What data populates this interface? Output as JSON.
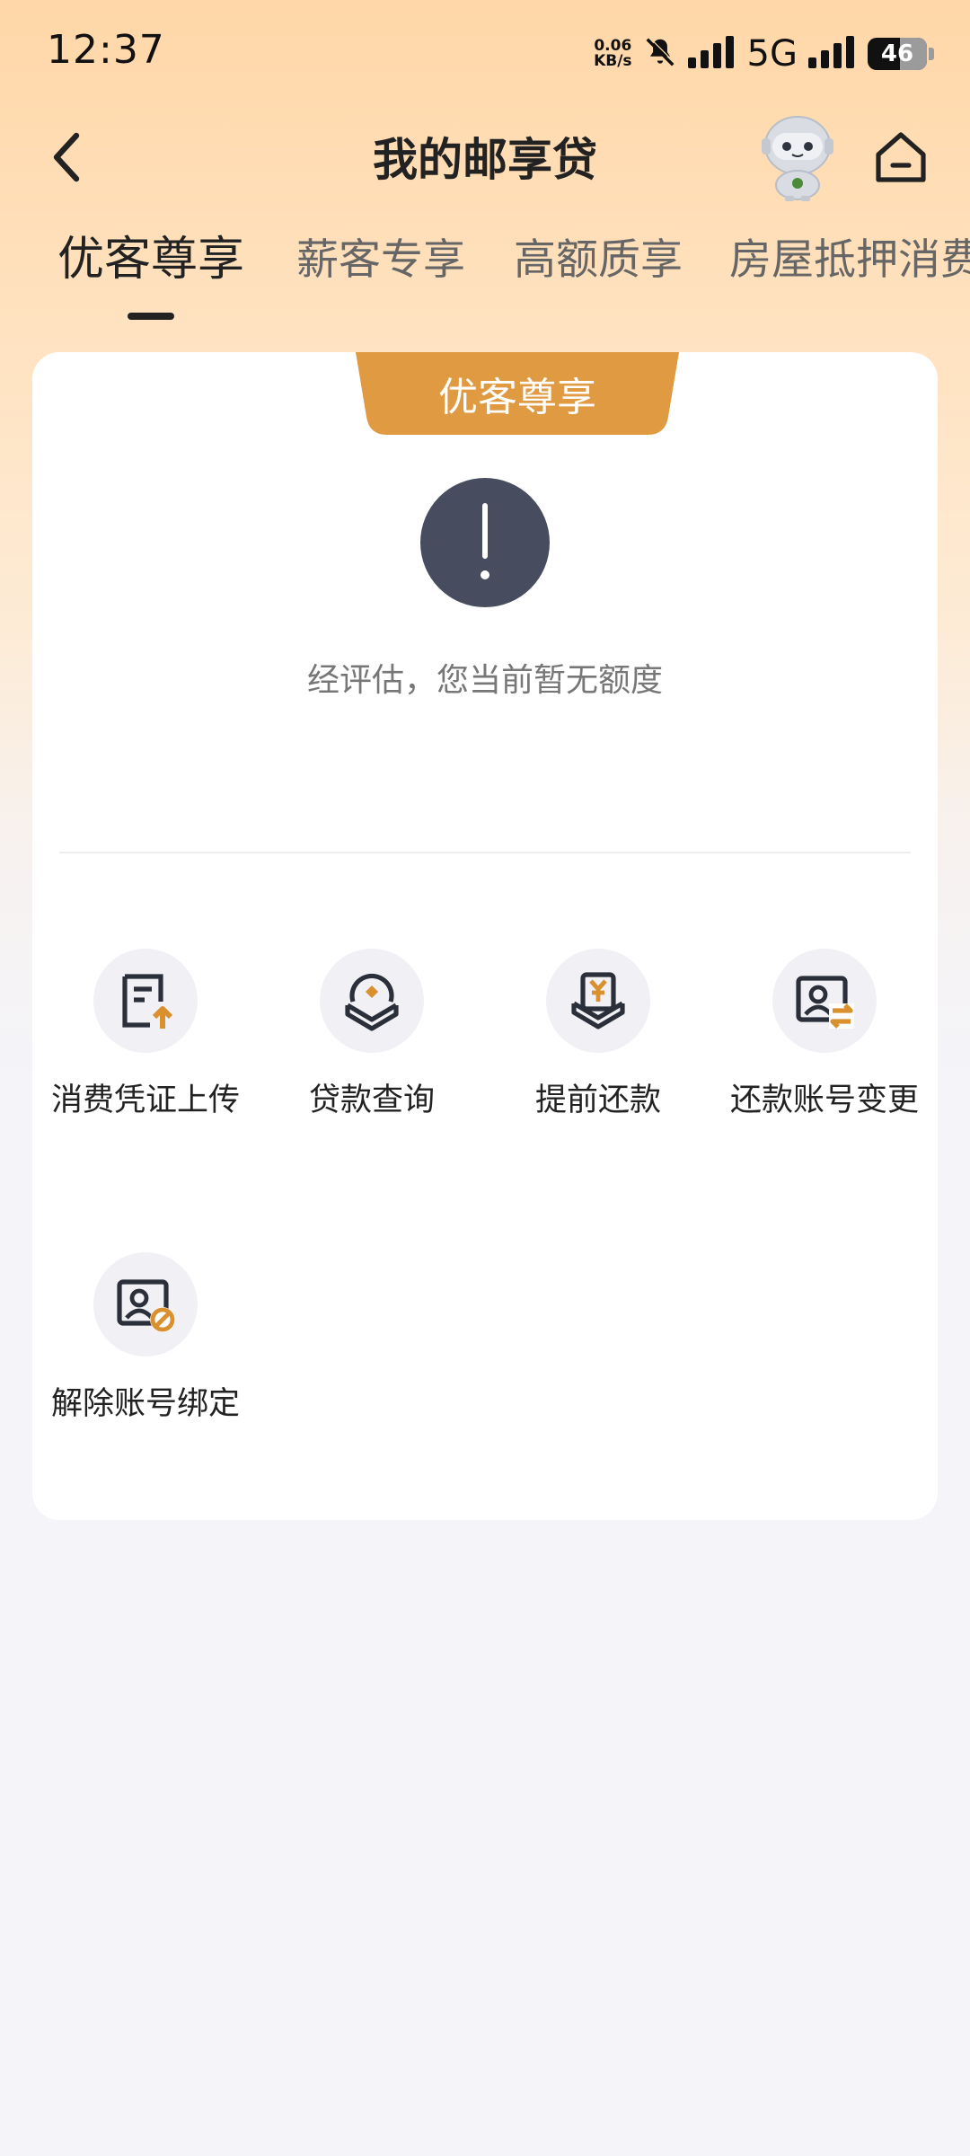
{
  "status_bar": {
    "time": "12:37",
    "net_speed_value": "0.06",
    "net_speed_unit": "KB/s",
    "network_type": "5G",
    "battery_level": "46",
    "icons": [
      "mute-icon",
      "signal-icon",
      "signal-icon"
    ]
  },
  "header": {
    "title": "我的邮享贷",
    "back_icon": "chevron-left-icon",
    "assistant_icon": "robot-assistant-icon",
    "home_icon": "home-icon"
  },
  "tabs": [
    {
      "label": "优客尊享",
      "active": true
    },
    {
      "label": "薪客专享",
      "active": false
    },
    {
      "label": "高额质享",
      "active": false
    },
    {
      "label": "房屋抵押消费",
      "active": false
    }
  ],
  "card": {
    "badge_label": "优客尊享",
    "status_icon": "exclamation-icon",
    "message": "经评估，您当前暂无额度",
    "actions": [
      {
        "label": "消费凭证上传",
        "icon": "voucher-upload-icon"
      },
      {
        "label": "贷款查询",
        "icon": "loan-query-icon"
      },
      {
        "label": "提前还款",
        "icon": "early-repayment-icon"
      },
      {
        "label": "还款账号变更",
        "icon": "account-change-icon"
      },
      {
        "label": "解除账号绑定",
        "icon": "account-unbind-icon"
      }
    ]
  },
  "colors": {
    "accent": "#e09a42",
    "header_bg": "#ffd7a8",
    "page_bg": "#f4f4f9",
    "alert_icon_bg": "#474d5e"
  }
}
